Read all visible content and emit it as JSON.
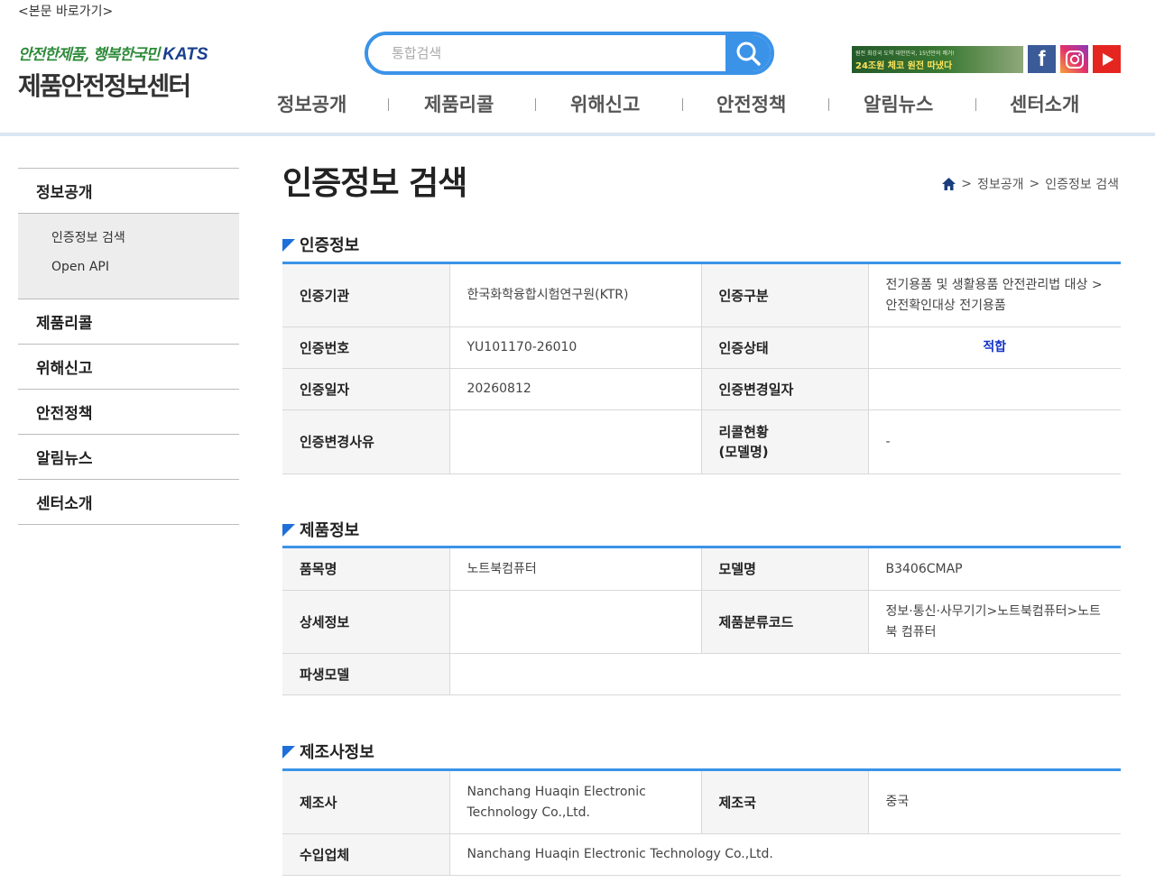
{
  "header": {
    "skip_link": "<본문 바로가기>",
    "logo_slogan": "안전한제품, 행복한국민",
    "logo_org": "KATS",
    "logo_name": "제품안전정보센터",
    "search": {
      "placeholder": "통합검색",
      "value": ""
    },
    "banner": {
      "line1": "원전 최강국 도약 대한민국, 15년만의 쾌거!",
      "line2": "24조원 체코 원전 따냈다"
    },
    "sns": [
      {
        "name": "facebook",
        "icon": "facebook-icon",
        "glyph": "f"
      },
      {
        "name": "instagram",
        "icon": "instagram-icon"
      },
      {
        "name": "youtube",
        "icon": "youtube-icon"
      }
    ],
    "nav": [
      "정보공개",
      "제품리콜",
      "위해신고",
      "안전정책",
      "알림뉴스",
      "센터소개"
    ]
  },
  "sidebar": {
    "items": [
      {
        "label": "정보공개",
        "sub": [
          "인증정보 검색",
          "Open API"
        ]
      },
      {
        "label": "제품리콜"
      },
      {
        "label": "위해신고"
      },
      {
        "label": "안전정책"
      },
      {
        "label": "알림뉴스"
      },
      {
        "label": "센터소개"
      }
    ]
  },
  "page": {
    "title": "인증정보 검색",
    "breadcrumb": [
      "정보공개",
      "인증정보 검색"
    ],
    "breadcrumb_sep": ">"
  },
  "cert": {
    "title": "인증정보",
    "agency_label": "인증기관",
    "agency": "한국화학융합시험연구원(KTR)",
    "type_label": "인증구분",
    "type": "전기용품 및 생활용품 안전관리법 대상 >안전확인대상 전기용품",
    "number_label": "인증번호",
    "number": "YU101170-26010",
    "status_label": "인증상태",
    "status": "적합",
    "date_label": "인증일자",
    "date": "20260812",
    "change_date_label": "인증변경일자",
    "change_date": "",
    "change_reason_label": "인증변경사유",
    "change_reason": "",
    "recall_label_1": "리콜현황",
    "recall_label_2": "(모델명)",
    "recall": "-"
  },
  "product": {
    "title": "제품정보",
    "item_label": "품목명",
    "item": "노트북컴퓨터",
    "model_label": "모델명",
    "model": "B3406CMAP",
    "detail_label": "상세정보",
    "detail": "",
    "class_label": "제품분류코드",
    "class": "정보·통신·사무기기>노트북컴퓨터>노트북 컴퓨터",
    "derived_label": "파생모델",
    "derived": ""
  },
  "maker": {
    "title": "제조사정보",
    "maker_label": "제조사",
    "maker": "Nanchang Huaqin Electronic Technology Co.,Ltd.",
    "country_label": "제조국",
    "country": "중국",
    "importer_label": "수입업체",
    "importer": "Nanchang Huaqin Electronic Technology Co.,Ltd."
  },
  "colors": {
    "accent": "#3b93e8",
    "status_ok": "#1533c7",
    "section_marker": "#1e6fd9"
  }
}
